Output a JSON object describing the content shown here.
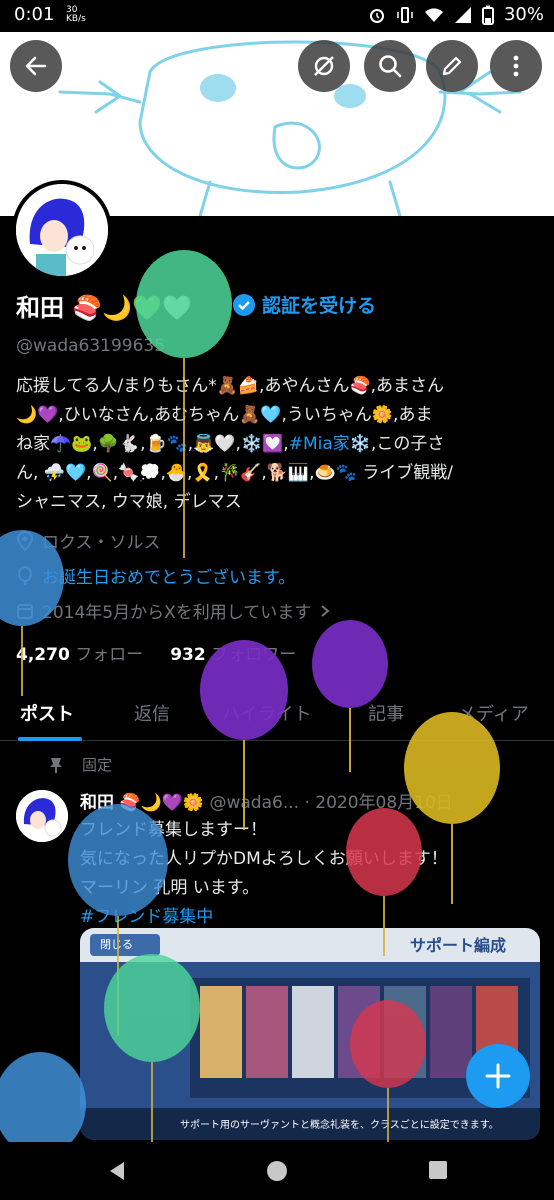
{
  "status_bar": {
    "time": "0:01",
    "speed_top": "30",
    "speed_unit": "KB/s",
    "battery": "30%"
  },
  "profile": {
    "name": "和田",
    "verify_label": "認証を受ける",
    "handle": "@wada63199635",
    "bio_line1": "応援してる人/まりもさん*🧸🍰,あやんさん🍣,あまさん",
    "bio_line2": "🌙💜,ひいなさん,あむちゃん🧸🩵,ういちゃん🌼,あま",
    "bio_line3": "ね家☂️🐸,🌳🐇,🍺🐾,👼🤍,❄️💟,",
    "bio_hashtag": "#Mia家",
    "bio_line3_end": "❄️,この子さ",
    "bio_line4": "ん, ⛈️🩵,🍭,🍬💭,🐣,🎗️,🎋🎸,🐕🎹,🍮🐾 ライブ観戦/",
    "bio_line5": "シャニマス, ウマ娘, デレマス",
    "location": "ロクス・ソルス",
    "birthday": "お誕生日おめでとうございます。",
    "joined": "2014年5月からXを利用しています",
    "following_count": "4,270",
    "following_label": "フォロー",
    "followers_count": "932",
    "followers_label": "フォロワー"
  },
  "tabs": [
    "ポスト",
    "返信",
    "ハイライト",
    "記事",
    "メディア"
  ],
  "post": {
    "pinned_label": "固定",
    "author": "和田",
    "handle": "@wada6...",
    "date": "· 2020年08月10日",
    "line1": "フレンド募集しますー！",
    "line2": "気になった人リプかDMよろしくお願いします！",
    "line3": "マーリン 孔明 います。",
    "hashtag": "#フレンド募集中",
    "image_title": "サポート編成",
    "image_close": "閉じる",
    "image_caption": "サポート用のサーヴァントと概念礼装を、クラスごとに設定できます。"
  },
  "colors": {
    "accent": "#1d9bf0",
    "background": "#000000",
    "muted": "#71767b"
  }
}
